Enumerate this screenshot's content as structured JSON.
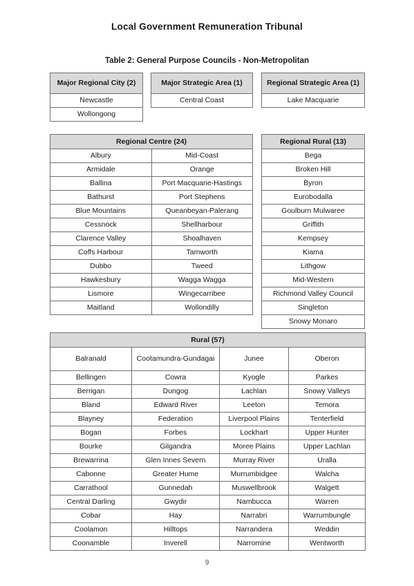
{
  "document": {
    "title": "Local Government Remuneration Tribunal",
    "table_caption": "Table 2: General Purpose Councils - Non-Metropolitan",
    "page_number": "9"
  },
  "style": {
    "header_fill": "#d9d9d9",
    "border_color": "#6f6f6f",
    "text_color": "#1a1a1a"
  },
  "tables": {
    "major_regional_city": {
      "header": "Major Regional City (2)",
      "rows": [
        "Newcastle",
        "Wollongong"
      ]
    },
    "major_strategic_area": {
      "header": "Major Strategic Area (1)",
      "rows": [
        "Central Coast"
      ]
    },
    "regional_strategic_area": {
      "header": "Regional Strategic Area (1)",
      "rows": [
        "Lake Macquarie"
      ]
    },
    "regional_centre": {
      "header": "Regional Centre (24)",
      "rows": [
        [
          "Albury",
          "Mid-Coast"
        ],
        [
          "Armidale",
          "Orange"
        ],
        [
          "Ballina",
          "Port Macquarie-Hastings"
        ],
        [
          "Bathurst",
          "Port Stephens"
        ],
        [
          "Blue Mountains",
          "Queanbeyan-Palerang"
        ],
        [
          "Cessnock",
          "Shellharbour"
        ],
        [
          "Clarence Valley",
          "Shoalhaven"
        ],
        [
          "Coffs Harbour",
          "Tamworth"
        ],
        [
          "Dubbo",
          "Tweed"
        ],
        [
          "Hawkesbury",
          "Wagga Wagga"
        ],
        [
          "Lismore",
          "Wingecarribee"
        ],
        [
          "Maitland",
          "Wollondilly"
        ]
      ]
    },
    "regional_rural": {
      "header": "Regional Rural (13)",
      "rows": [
        "Bega",
        "Broken Hill",
        "Byron",
        "Eurobodalla",
        "Goulburn Mulwaree",
        "Griffith",
        "Kempsey",
        "Kiama",
        "Lithgow",
        "Mid-Western",
        "Richmond Valley Council",
        "Singleton",
        "Snowy Monaro"
      ]
    },
    "rural": {
      "header": "Rural (57)",
      "rows": [
        [
          "Balranald",
          "Cootamundra-Gundagai",
          "Junee",
          "Oberon"
        ],
        [
          "Bellingen",
          "Cowra",
          "Kyogle",
          "Parkes"
        ],
        [
          "Berrigan",
          "Dungog",
          "Lachlan",
          "Snowy Valleys"
        ],
        [
          "Bland",
          "Edward River",
          "Leeton",
          "Temora"
        ],
        [
          "Blayney",
          "Federation",
          "Liverpool Plains",
          "Tenterfield"
        ],
        [
          "Bogan",
          "Forbes",
          "Lockhart",
          "Upper Hunter"
        ],
        [
          "Bourke",
          "Gilgandra",
          "Moree Plains",
          "Upper Lachlan"
        ],
        [
          "Brewarrina",
          "Glen Innes Severn",
          "Murray River",
          "Uralla"
        ],
        [
          "Cabonne",
          "Greater Hume",
          "Murrumbidgee",
          "Walcha"
        ],
        [
          "Carrathool",
          "Gunnedah",
          "Muswellbrook",
          "Walgett"
        ],
        [
          "Central Darling",
          "Gwydir",
          "Nambucca",
          "Warren"
        ],
        [
          "Cobar",
          "Hay",
          "Narrabri",
          "Warrumbungle"
        ],
        [
          "Coolamon",
          "Hilltops",
          "Narrandera",
          "Weddin"
        ],
        [
          "Coonamble",
          "Inverell",
          "Narromine",
          "Wentworth"
        ]
      ]
    }
  }
}
